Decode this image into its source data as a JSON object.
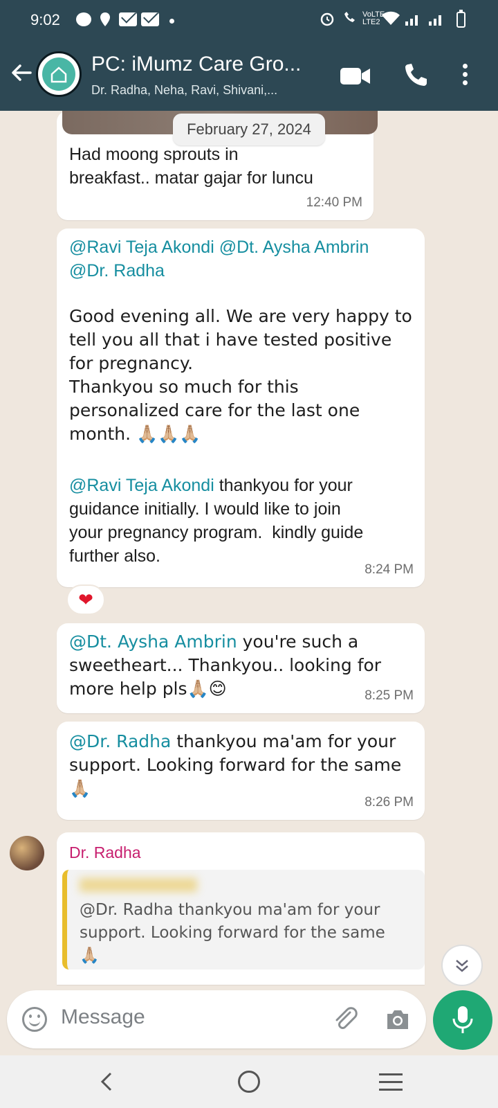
{
  "status_bar": {
    "time": "9:02",
    "network": "LTE2",
    "volte": "VoLTE"
  },
  "header": {
    "title": "PC: iMumz Care Gro...",
    "subtitle": "Dr. Radha, Neha, Ravi, Shivani,...",
    "icons": [
      "back-arrow-icon",
      "video-call-icon",
      "phone-icon",
      "more-vertical-icon"
    ]
  },
  "date_chip": "February 27, 2024",
  "messages": [
    {
      "text": "Had moong sprouts in\nbreakfast.. matar gajar for luncu",
      "time": "12:40 PM"
    },
    {
      "mention_1": "@Ravi Teja Akondi @Dt. Aysha Ambrin\n@Dr. Radha",
      "body_1": "Good evening all. We are very happy to\ntell you all that i have tested positive\nfor pregnancy.\nThankyou so much for this\npersonalized care for the last one\nmonth. 🙏🏼🙏🏼🙏🏼",
      "mention_2": "@Ravi Teja Akondi",
      "body_2": " thankyou for your\nguidance initially. I would like to join\nyour pregnancy program.  kindly guide\nfurther also.",
      "time": "8:24 PM",
      "reaction": "❤"
    },
    {
      "mention": "@Dt. Aysha Ambrin",
      "body": " you're such a\nsweetheart... Thankyou.. looking for\nmore help pls🙏🏼😊",
      "time": "8:25 PM"
    },
    {
      "mention": "@Dr. Radha",
      "body": " thankyou ma'am for your\nsupport. Looking forward for the same\n🙏🏼",
      "time": "8:26 PM"
    },
    {
      "sender": "Dr. Radha",
      "quoted_text": "@Dr. Radha thankyou ma'am for your\nsupport. Looking forward for the same\n🙏🏼"
    }
  ],
  "input": {
    "placeholder": "Message"
  },
  "colors": {
    "header": "#2d4854",
    "accent": "#1fa874",
    "mention": "#168ea0",
    "sender": "#c71e6e",
    "quote_bar": "#e8bd2c"
  }
}
